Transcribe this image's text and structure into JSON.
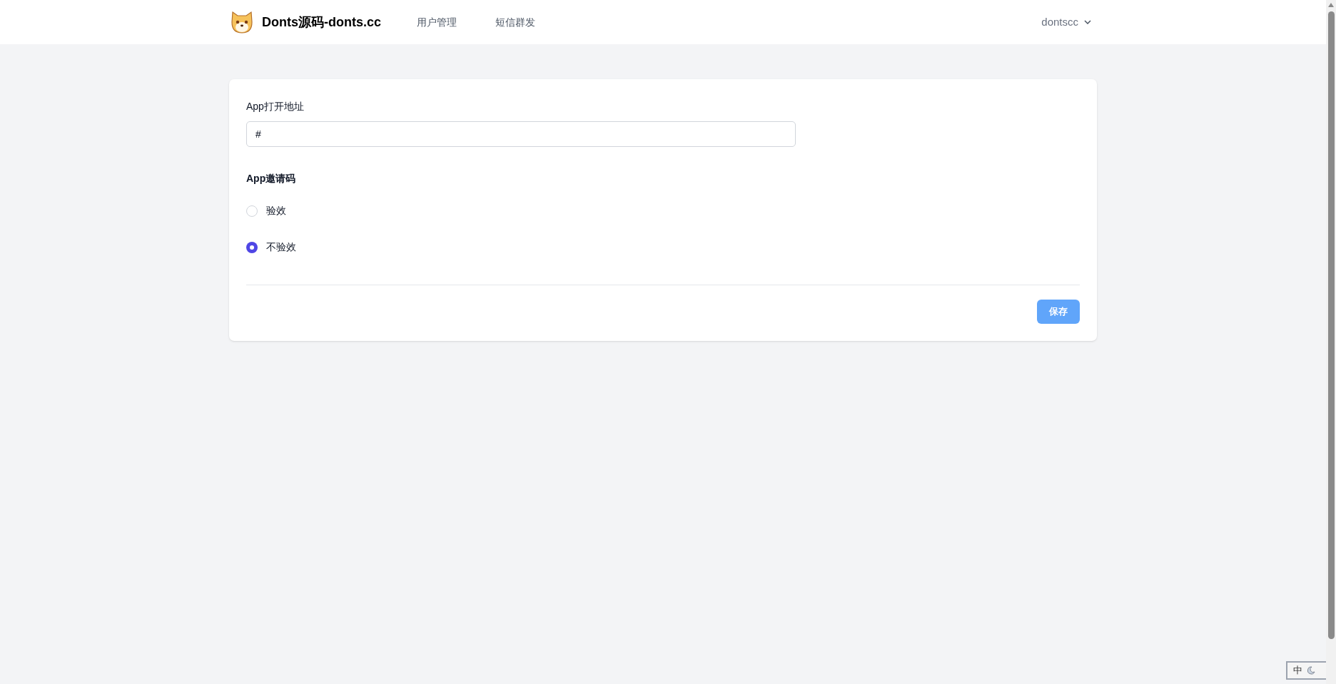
{
  "header": {
    "brand": "Donts源码-donts.cc",
    "nav": [
      {
        "label": "用户管理",
        "selected": false
      },
      {
        "label": "短信群发",
        "selected": false
      }
    ],
    "user": "dontscc"
  },
  "form": {
    "url_field": {
      "label": "App打开地址",
      "value": "#"
    },
    "invite": {
      "heading": "App邀请码",
      "options": [
        {
          "label": "验效",
          "selected": false
        },
        {
          "label": "不验效",
          "selected": true
        }
      ]
    },
    "save_button": "保存"
  },
  "ime_bar": {
    "mode": "中"
  }
}
